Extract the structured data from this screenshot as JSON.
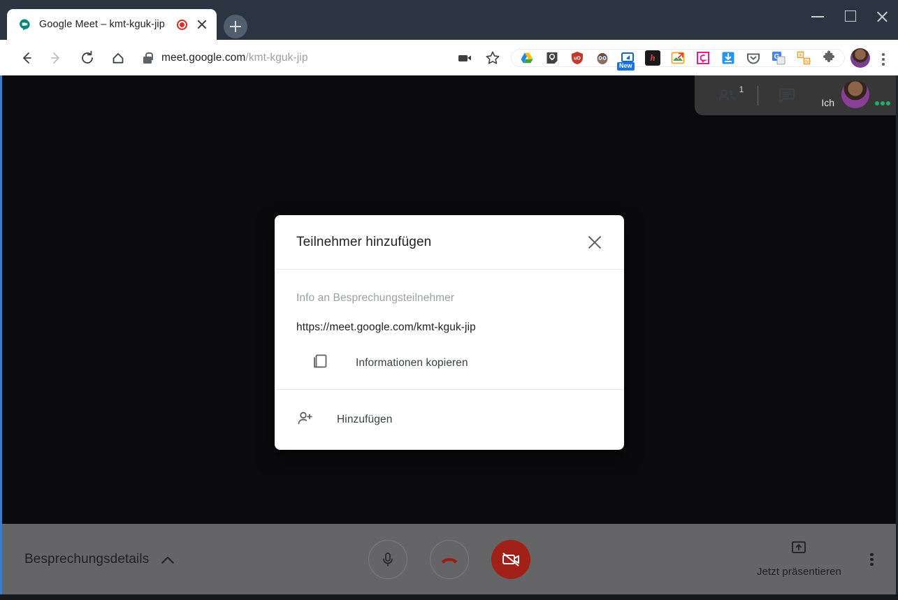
{
  "browser": {
    "tab": {
      "title": "Google Meet – kmt-kguk-jip",
      "favicon": "google-meet-icon",
      "recording_indicator": "recording-dot-icon",
      "close": "close-icon"
    },
    "new_tab_label": "+",
    "window_controls": {
      "minimize": "minimize-icon",
      "maximize": "maximize-icon",
      "close": "close-icon"
    },
    "nav": {
      "back": "back-arrow-icon",
      "forward": "forward-arrow-icon",
      "reload": "reload-icon",
      "home": "home-icon"
    },
    "omnibox": {
      "lock": "lock-icon",
      "host": "meet.google.com",
      "path": "/kmt-kguk-jip"
    },
    "toolbar_icons": [
      {
        "name": "camera-share-icon",
        "label": ""
      },
      {
        "name": "bookmark-star-icon",
        "label": ""
      }
    ],
    "extensions": [
      {
        "name": "google-drive-extension",
        "label": ""
      },
      {
        "name": "keep-note-extension",
        "label": ""
      },
      {
        "name": "ublock-origin-extension",
        "label": "uO"
      },
      {
        "name": "privacy-badger-extension",
        "label": ""
      },
      {
        "name": "screenshot-extension",
        "label": "",
        "badge": "New"
      },
      {
        "name": "hypothesis-extension",
        "label": "h"
      },
      {
        "name": "image-tools-extension",
        "label": ""
      },
      {
        "name": "pinterest-extension",
        "label": ""
      },
      {
        "name": "video-downloader-extension",
        "label": ""
      },
      {
        "name": "pocket-extension",
        "label": ""
      },
      {
        "name": "google-translate-extension",
        "label": "G"
      },
      {
        "name": "xml-converter-extension",
        "label": ""
      },
      {
        "name": "extensions-puzzle-icon",
        "label": ""
      }
    ],
    "profile_avatar": "profile-avatar",
    "menu": "chrome-menu-icon"
  },
  "meet": {
    "top_bar": {
      "participants_icon": "people-icon",
      "participants_count": "1",
      "chat_icon": "chat-icon",
      "self_label": "Ich",
      "self_avatar": "self-avatar",
      "mic_activity": "mic-activity-dots"
    },
    "dialog": {
      "title": "Teilnehmer hinzufügen",
      "close_icon": "close-icon",
      "subtitle": "Info an Besprechungsteilnehmer",
      "link": "https://meet.google.com/kmt-kguk-jip",
      "copy_icon": "copy-icon",
      "copy_label": "Informationen kopieren",
      "add_icon": "person-add-icon",
      "add_label": "Hinzufügen"
    },
    "bottom_bar": {
      "meeting_details_label": "Besprechungsdetails",
      "meeting_details_chevron": "chevron-up-icon",
      "mic_button": "microphone-icon",
      "hangup_button": "hangup-phone-icon",
      "camera_button": "camera-off-icon",
      "present_icon": "present-screen-icon",
      "present_label": "Jetzt präsentieren",
      "more_options": "more-options-icon"
    }
  },
  "colors": {
    "titlebar": "#2b3541",
    "page_bg": "#0b0b0d",
    "bottom_bar": "#656567",
    "danger": "#a12018",
    "accent_blue": "#1a73e8",
    "window_edge": "#3b7cc4",
    "mic_green": "#1fae6c"
  }
}
